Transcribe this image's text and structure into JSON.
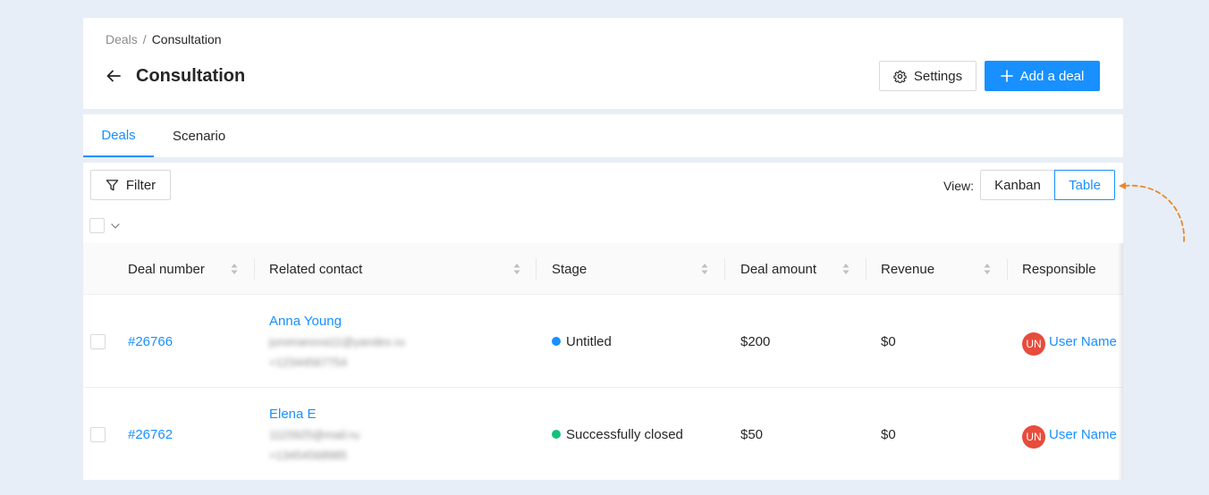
{
  "breadcrumb": {
    "parent": "Deals",
    "separator": "/",
    "current": "Consultation"
  },
  "header": {
    "title": "Consultation",
    "settings_label": "Settings",
    "add_deal_label": "Add a deal"
  },
  "tabs": [
    {
      "label": "Deals",
      "active": true
    },
    {
      "label": "Scenario",
      "active": false
    }
  ],
  "toolbar": {
    "filter_label": "Filter",
    "view_label": "View:",
    "view_options": [
      "Kanban",
      "Table"
    ],
    "view_selected": "Table"
  },
  "table": {
    "columns": [
      "Deal number",
      "Related contact",
      "Stage",
      "Deal amount",
      "Revenue",
      "Responsible"
    ],
    "rows": [
      {
        "deal_number": "#26766",
        "contact_name": "Anna Young",
        "contact_email": "juromanova11@yandex.ru",
        "contact_phone": "+12344567754",
        "stage": "Untitled",
        "stage_color": "#1890ff",
        "deal_amount": "$200",
        "revenue": "$0",
        "responsible_initials": "UN",
        "responsible_name": "User Name"
      },
      {
        "deal_number": "#26762",
        "contact_name": "Elena E",
        "contact_email": "1115925@mail.ru",
        "contact_phone": "+13454568985",
        "stage": "Successfully closed",
        "stage_color": "#13c27a",
        "deal_amount": "$50",
        "revenue": "$0",
        "responsible_initials": "UN",
        "responsible_name": "User Name"
      }
    ]
  },
  "colors": {
    "accent": "#1890ff",
    "background": "#e8eef7",
    "avatar": "#e74c3c",
    "annotation": "#e8892b"
  }
}
